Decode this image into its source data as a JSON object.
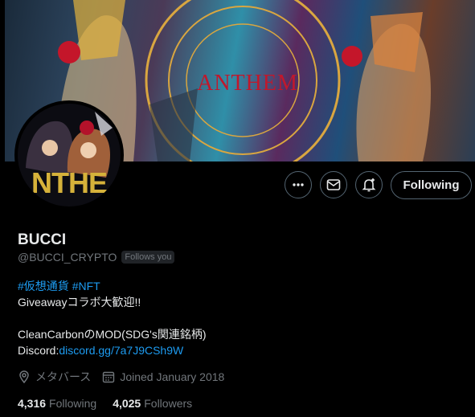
{
  "banner": {
    "title": "ANTHEM"
  },
  "avatar": {
    "text": "NTHE"
  },
  "actions": {
    "more_icon": "more-horizontal-icon",
    "message_icon": "envelope-icon",
    "notify_icon": "bell-plus-icon",
    "following_label": "Following"
  },
  "profile": {
    "name": "BUCCI",
    "handle": "@BUCCI_CRYPTO",
    "follows_you": "Follows you"
  },
  "bio": {
    "hashtag1": "#仮想通貨",
    "hashtag2": "#NFT",
    "line2": "Giveawayコラボ大歓迎!!",
    "line3": "CleanCarbonのMOD(SDG's関連銘柄)",
    "discord_label": "Discord:",
    "discord_link": "discord.gg/7a7J9CSh9W"
  },
  "meta": {
    "location": "メタバース",
    "joined": "Joined January 2018"
  },
  "stats": {
    "following_count": "4,316",
    "following_label": "Following",
    "followers_count": "4,025",
    "followers_label": "Followers"
  },
  "colors": {
    "accent": "#1d9bf0",
    "muted": "#71767b",
    "text": "#e7e9ea"
  }
}
